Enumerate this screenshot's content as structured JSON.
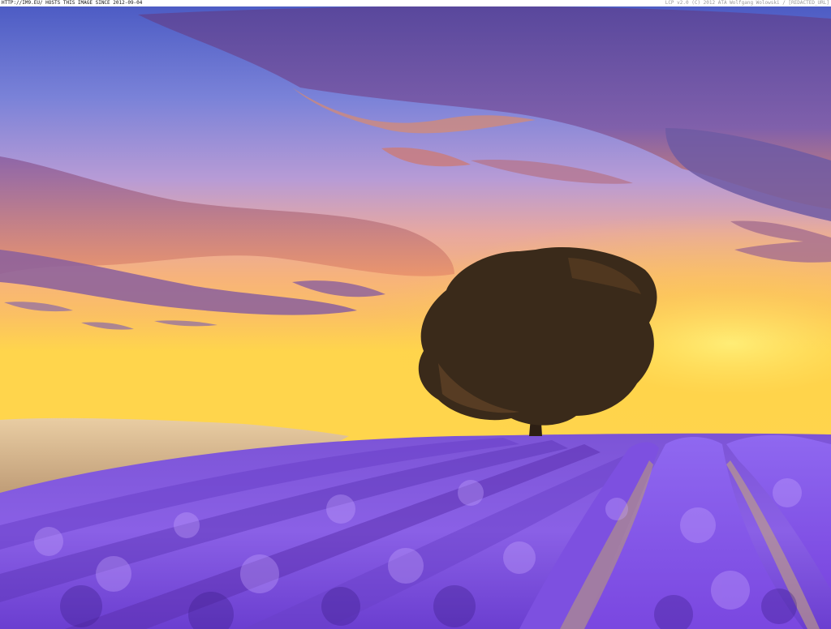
{
  "caption": {
    "left_text": "HTTP://IM9.EU/ HOSTS THIS IMAGE SINCE 2012-09-04",
    "right_text": "LCP v2.0 (C) 2012 ATA Wolfgang Wolowski / [REDACTED_URL]"
  },
  "colors": {
    "sky_top": "#4e5fc8",
    "sky_mid": "#9a86c9",
    "sky_glow": "#f6b46a",
    "horizon": "#ffd24a",
    "cloud_purple": "#6a4e9c",
    "cloud_orange": "#e38a5d",
    "tree_dark": "#3a2a1a",
    "lavender_light": "#9b6cf0",
    "lavender_dark": "#4b2aa8",
    "wheat": "#d8b88a",
    "soil": "#b99a7a"
  },
  "scene": {
    "description_icon": "lavender-field-photo"
  }
}
